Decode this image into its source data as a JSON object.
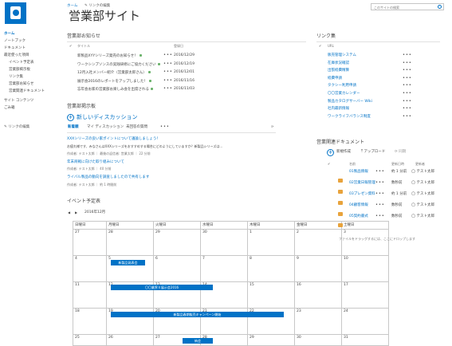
{
  "header": {
    "home": "ホーム",
    "edit_links": "リンクの編集",
    "site_title": "営業部サイト",
    "search_placeholder": "このサイトの検索"
  },
  "nav": {
    "items": [
      {
        "label": "ホーム",
        "level": 0,
        "selected": true
      },
      {
        "label": "ノートブック",
        "level": 0
      },
      {
        "label": "ドキュメント",
        "level": 0
      },
      {
        "label": "最近使った項目",
        "level": 0
      },
      {
        "label": "イベント予定表",
        "level": 1
      },
      {
        "label": "営業部掲示板",
        "level": 1
      },
      {
        "label": "リンク集",
        "level": 1
      },
      {
        "label": "営業部お知らせ",
        "level": 1
      },
      {
        "label": "営業関連ドキュメント",
        "level": 1
      },
      {
        "label": "サイト コンテンツ",
        "level": 0
      },
      {
        "label": "ごみ箱",
        "level": 0
      }
    ],
    "edit_links": "リンクの編集"
  },
  "news": {
    "title": "営業部お知らせ",
    "col_title": "タイトル",
    "col_date": "登録日",
    "rows": [
      {
        "title": "新製品XYYシリーズ発売のお知らせ！",
        "date": "2016/12/29"
      },
      {
        "title": "ワークシンプソンスの実践研修にご協力ください",
        "date": "2016/12/19"
      },
      {
        "title": "12月入社メンバー紹介（営業部太郎さん）",
        "date": "2016/12/01"
      },
      {
        "title": "展示会2016のレポートをアップしました！",
        "date": "2016/11/16"
      },
      {
        "title": "忘年会お家の営業部お楽しみ会を出席される",
        "date": "2016/11/03"
      }
    ]
  },
  "board": {
    "title": "営業部掲示板",
    "new_discussion": "新しいディスカッション",
    "tabs": [
      "新着順",
      "マイ ディスカッション",
      "未回答の質問"
    ],
    "posts": [
      {
        "title": "XXXシリーズの良い家ポイントについて議論しましょう！",
        "body": "お疲れ様です、みなさんはXXXシリーズをおすすめする場合にどのようにしていますか？新製品シリーズは…",
        "meta": "作成者: テスト太郎 ｜ 最後の返信者: 営業太郎 ｜ 22 分前"
      },
      {
        "title": "年末商戦に向けた取り組みについて",
        "meta": "作成者: テスト太郎 ｜ 40 分前"
      },
      {
        "title": "ライバル製品の動向を調査しましたので共有します",
        "meta": "作成者: テスト太郎 ｜ 約 1 時間前"
      }
    ]
  },
  "calendar": {
    "title": "イベント予定表",
    "month": "2016年12月",
    "weekdays": [
      "日曜日",
      "月曜日",
      "火曜日",
      "水曜日",
      "木曜日",
      "金曜日",
      "土曜日"
    ],
    "weeks": [
      [
        "27",
        "28",
        "29",
        "30",
        "1",
        "2",
        "3"
      ],
      [
        "4",
        "5",
        "6",
        "7",
        "8",
        "9",
        "10"
      ],
      [
        "11",
        "12",
        "13",
        "14",
        "15",
        "16",
        "17"
      ],
      [
        "18",
        "19",
        "20",
        "21",
        "22",
        "23",
        "24"
      ],
      [
        "25",
        "26",
        "27",
        "28",
        "29",
        "30",
        "31"
      ]
    ],
    "events": [
      "新製品発表会",
      "〇〇業界Ｘ展示会2016",
      "新製品春期販売キャンペーン開始",
      "納会"
    ]
  },
  "links": {
    "title": "リンク集",
    "col": "URL",
    "items": [
      "販売管理システム",
      "在庫状況確認",
      "出張経費精算",
      "経費申請",
      "タクシー利用申請",
      "〇〇営業カレンダー",
      "製品カタログサーバー Wiki",
      "社内最新情報",
      "ワークライフバランス制度"
    ]
  },
  "docs": {
    "title": "営業関連ドキュメント",
    "new": "新規作成",
    "upload": "アップロード",
    "sync": "同期",
    "col_name": "名前",
    "col_modified": "更新日時",
    "col_modifier": "更新者",
    "rows": [
      {
        "name": "01製品情報",
        "modified": "約 1 分前",
        "modifier": "テスト太郎"
      },
      {
        "name": "02営業日報管理",
        "modified": "数秒前",
        "modifier": "テスト太郎"
      },
      {
        "name": "03プレゼン資料",
        "modified": "約 1 分前",
        "modifier": "テスト太郎"
      },
      {
        "name": "04顧客情報",
        "modified": "数秒前",
        "modifier": "テスト太郎"
      },
      {
        "name": "05契約書式",
        "modified": "数秒前",
        "modifier": "テスト太郎"
      }
    ],
    "drop_hint": "ファイルをドラッグするには、ここにドロップします"
  },
  "colors": {
    "accent": "#0072c6",
    "folder": "#e8a33c"
  }
}
